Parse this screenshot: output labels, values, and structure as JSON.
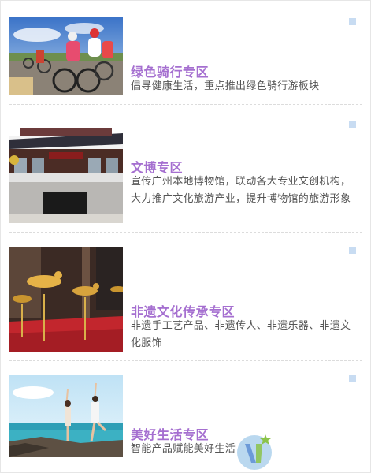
{
  "items": [
    {
      "title": "绿色骑行专区",
      "description": "倡导健康生活，重点推出绿色骑行游板块",
      "image": "cycling-race-photo"
    },
    {
      "title": "文博专区",
      "description": "宣传广州本地博物馆，联动各大专业文创机构，大力推广文化旅游产业，提升博物馆的旅游形象",
      "image": "museum-building-photo"
    },
    {
      "title": "非遗文化传承专区",
      "description": "非遗手工艺产品、非遗传人、非遗乐器、非遗文化服饰",
      "image": "golden-horse-craft-photo"
    },
    {
      "title": "美好生活专区",
      "description": "智能产品赋能美好生活",
      "image": "yoga-beach-photo"
    }
  ],
  "colors": {
    "title": "#a56fd0",
    "description": "#555555",
    "corner_marker": "#c8dcf2"
  },
  "watermark_icon": "brand-logo-icon"
}
